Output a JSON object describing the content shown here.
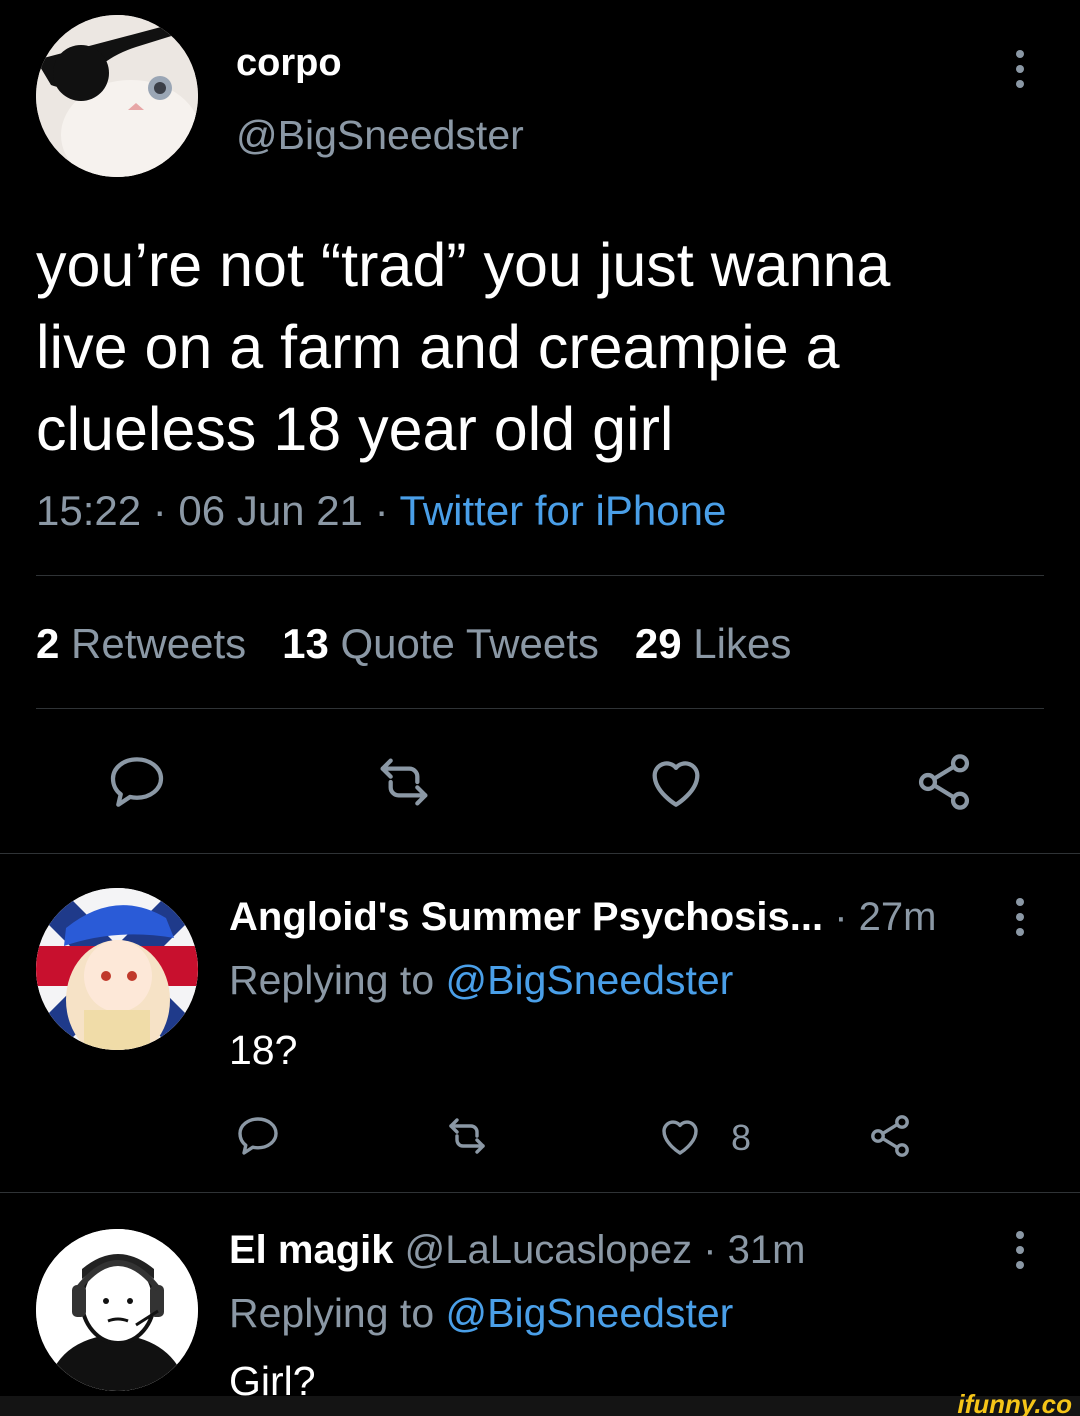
{
  "tweet": {
    "author_name": "corpo",
    "author_handle": "@BigSneedster",
    "text_lines": [
      "you’re not “trad” you just wanna",
      "live on a farm and creampie a",
      "clueless 18 year old girl"
    ],
    "time": "15:22 · 06 Jun 21 · ",
    "source": "Twitter for iPhone",
    "stats": {
      "retweets_count": "2",
      "retweets_label": "Retweets",
      "quotes_count": "13",
      "quotes_label": "Quote Tweets",
      "likes_count": "29",
      "likes_label": "Likes"
    },
    "icons": [
      "reply-icon",
      "retweet-icon",
      "like-icon",
      "share-icon",
      "more-icon"
    ]
  },
  "replies": [
    {
      "name": "Angloid's Summer Psychosis...",
      "handle": "",
      "time": " · 27m",
      "replying_label": "Replying to ",
      "replying_handle": "@BigSneedster",
      "text": "18?",
      "like_count": "8"
    },
    {
      "name": "El magik",
      "handle": " @LaLucaslopez",
      "time": " · 31m",
      "replying_label": "Replying to ",
      "replying_handle": "@BigSneedster",
      "text": "Girl?"
    }
  ],
  "watermark": "ifunny.co",
  "colors": {
    "background": "#000000",
    "muted": "#8b98a5",
    "link": "#4a9fe8",
    "divider": "#2f3336"
  }
}
